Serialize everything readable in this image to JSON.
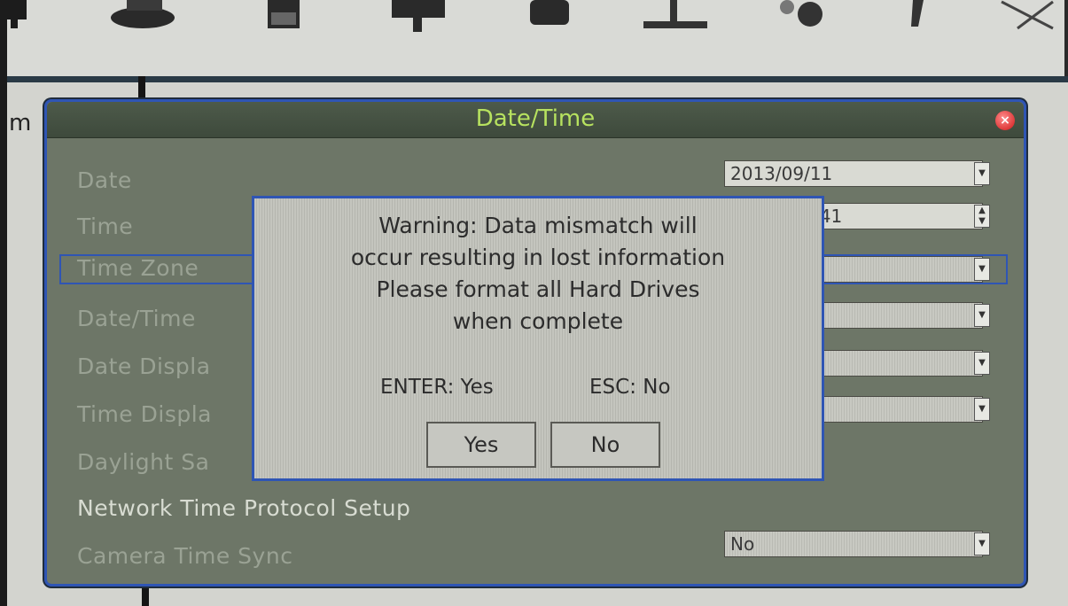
{
  "side_text": "m",
  "toolbar": {
    "icons": [
      "monitor-icon",
      "camera-icon",
      "calendar-icon",
      "display-icon",
      "devices-icon",
      "network-icon",
      "gear-icon",
      "tool-icon",
      "antenna-icon"
    ]
  },
  "dialog": {
    "title": "Date/Time",
    "rows": {
      "date": "Date",
      "time": "Time",
      "time_zone": "Time Zone",
      "datetime": "Date/Time",
      "date_display": "Date Displa",
      "time_display": "Time Displa",
      "daylight": "Daylight Sa",
      "ntp": "Network Time Protocol Setup",
      "camera_sync": "Camera Time Sync"
    },
    "fields": {
      "date_value": "2013/09/11",
      "time_value": ":41",
      "camera_sync_value": "No"
    }
  },
  "warning": {
    "lines": [
      "Warning: Data mismatch will",
      "occur resulting in lost information",
      "Please format all Hard Drives",
      "when complete"
    ],
    "enter_hint": "ENTER: Yes",
    "esc_hint": "ESC: No",
    "yes": "Yes",
    "no": "No"
  },
  "colors": {
    "title": "#b7e25f",
    "accent": "#2f55b4",
    "dialog_bg": "#6d7667"
  }
}
